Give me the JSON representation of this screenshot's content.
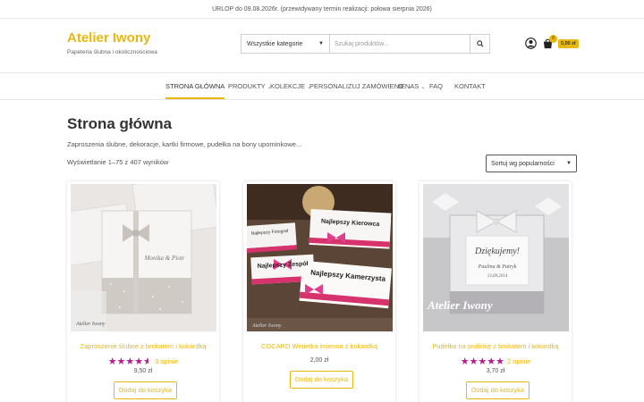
{
  "notice": "URLOP do 09.08.2026r. (przewidywany termin realizacji: połowa sierpnia 2026)",
  "brand": {
    "title": "Atelier Iwony",
    "tagline": "Papeteria ślubna i okolicznościowa"
  },
  "search": {
    "category": "Wszystkie kategorie",
    "placeholder": "Szukaj produktów..."
  },
  "cart": {
    "count": "0",
    "total": "0,00 zł"
  },
  "nav": [
    {
      "label": "STRONA GŁÓWNA"
    },
    {
      "label": "PRODUKTY"
    },
    {
      "label": "KOLEKCJE"
    },
    {
      "label": "PERSONALIZUJ ZAMÓWIENIE"
    },
    {
      "label": "O NAS"
    },
    {
      "label": "FAQ"
    },
    {
      "label": "KONTAKT"
    }
  ],
  "page": {
    "title": "Strona główna",
    "description": "Zaproszenia ślubne, dekoracje, kartki firmowe, pudełka na bony upominkowe...",
    "results": "Wyświetlanie 1–75 z 407 wyników",
    "sort": "Sortuj wg popularności"
  },
  "products": [
    {
      "title": "Zaproszenie ślubne z brokatem i kokardką",
      "rating": 4.5,
      "reviews": "3 opinie",
      "price": "9,50 zł",
      "button": "Dodaj do koszyka",
      "image_text": "Monika & Piotr",
      "watermark": "Atelier Iwony"
    },
    {
      "title": "COCARD Winietka imienna z kokardką",
      "price": "2,00 zł",
      "button": "Dodaj do koszyka",
      "image_lines": [
        "Najlepszy Fotograf",
        "Najlepszy Kierowca",
        "Najlepszy Zespół",
        "Najlepszy Kamerzysta"
      ],
      "watermark": "Atelier Iwony"
    },
    {
      "title": "Pudełko na pralinkę z brokatem i kokardką",
      "rating": 5,
      "reviews": "2 opinie",
      "price": "3,70 zł",
      "button": "Dodaj do koszyka",
      "image_text": "Dziękujemy!",
      "image_sub": "Paulina & Patryk",
      "image_date": "13.09.2014",
      "watermark": "Atelier Iwony"
    }
  ],
  "colors": {
    "accent": "#e8b811",
    "stars": "#b31d8f"
  }
}
